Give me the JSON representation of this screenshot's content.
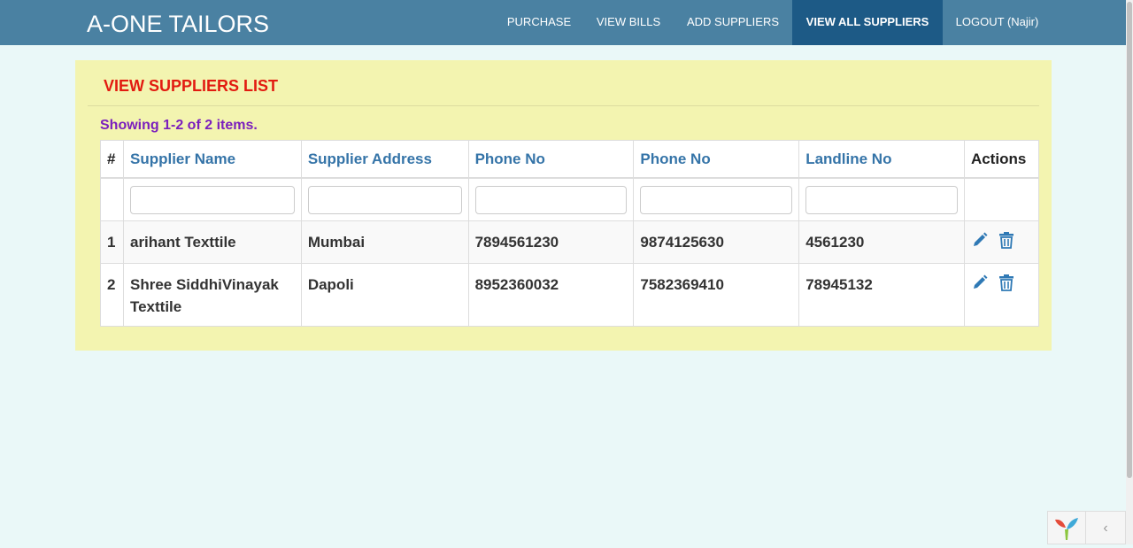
{
  "brand": "A-ONE TAILORS",
  "nav": {
    "purchase": "PURCHASE",
    "view_bills": "VIEW BILLS",
    "add_suppliers": "ADD SUPPLIERS",
    "view_all_suppliers": "VIEW ALL SUPPLIERS",
    "logout": "LOGOUT (Najir)"
  },
  "panel": {
    "title": "VIEW SUPPLIERS LIST",
    "summary": "Showing 1-2 of 2 items."
  },
  "table": {
    "headers": {
      "index": "#",
      "name": "Supplier Name",
      "address": "Supplier Address",
      "phone1": "Phone No",
      "phone2": "Phone No",
      "landline": "Landline No",
      "actions": "Actions"
    },
    "rows": [
      {
        "index": "1",
        "name": "arihant Texttile",
        "address": "Mumbai",
        "phone1": "7894561230",
        "phone2": "9874125630",
        "landline": "4561230"
      },
      {
        "index": "2",
        "name": "Shree SiddhiVinayak Texttile",
        "address": "Dapoli",
        "phone1": "8952360032",
        "phone2": "7582369410",
        "landline": "78945132"
      }
    ],
    "action_icons": [
      "pencil-icon",
      "trash-icon"
    ]
  },
  "debug_toolbar": {
    "logo_icon": "yii-logo-icon",
    "toggle_glyph": "‹"
  },
  "colors": {
    "navbar": "#4a81a2",
    "nav_active": "#1d5a86",
    "panel": "#f3f4b0",
    "title": "#e21b10",
    "summary": "#7b1fbd",
    "header_link": "#3574a8",
    "page_bg": "#eaf8f8"
  }
}
